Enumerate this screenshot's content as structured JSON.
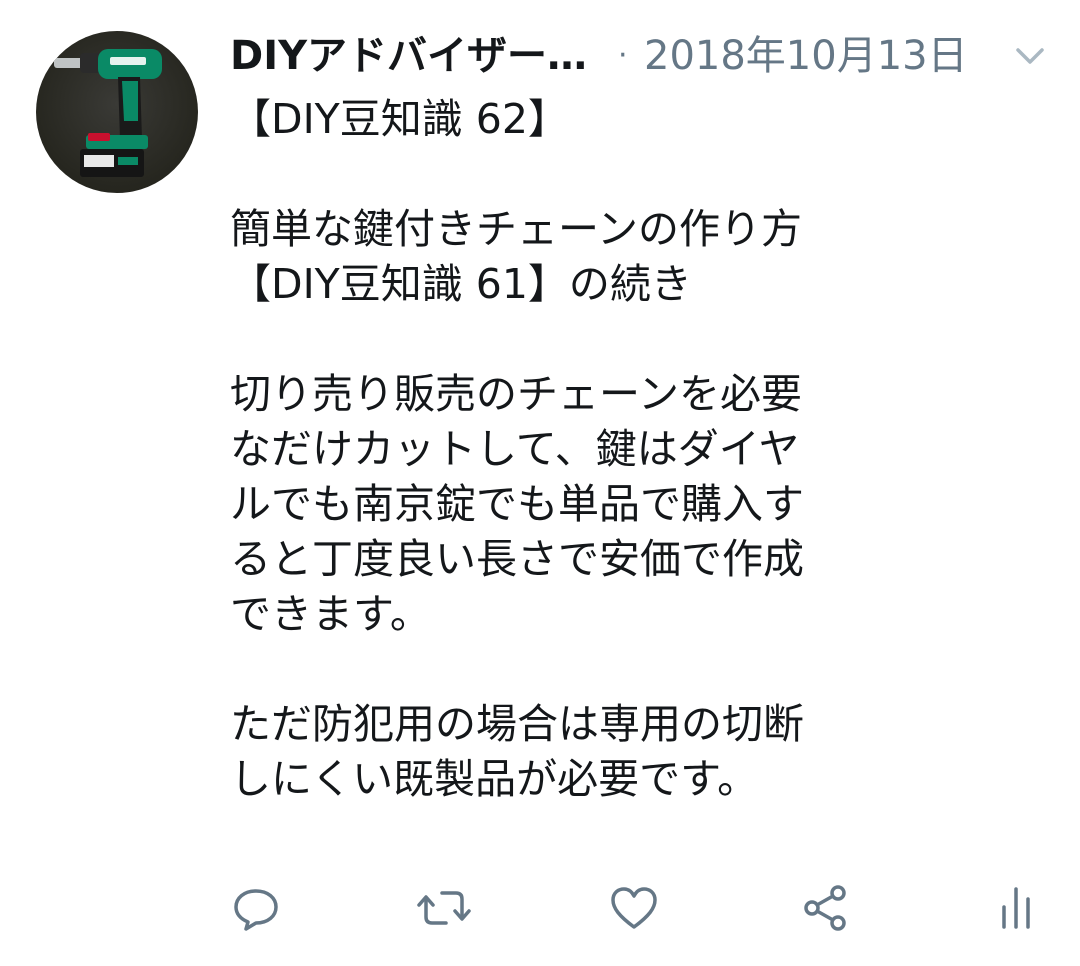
{
  "tweet": {
    "author_name": "DIYアドバイザー…",
    "separator": "·",
    "date": "2018年10月13日",
    "body": "【DIY豆知識 62】\n\n簡単な鍵付きチェーンの作り方\n【DIY豆知識 61】の続き\n\n切り売り販売のチェーンを必要\nなだけカットして、鍵はダイヤ\nルでも南京錠でも単品で購入す\nると丁度良い長さで安価で作成\nできます。\n\nただ防犯用の場合は専用の切断\nしにくい既製品が必要です。",
    "avatar_icon": "impact-driver-photo"
  },
  "icons": {
    "menu": "chevron-down-icon",
    "reply": "reply-icon",
    "retweet": "retweet-icon",
    "like": "heart-icon",
    "share": "share-icon",
    "analytics": "analytics-icon"
  },
  "colors": {
    "text": "#14171a",
    "secondary": "#657786",
    "icon": "#657786",
    "drill_green": "#0a8a66",
    "drill_red": "#c8102e"
  }
}
